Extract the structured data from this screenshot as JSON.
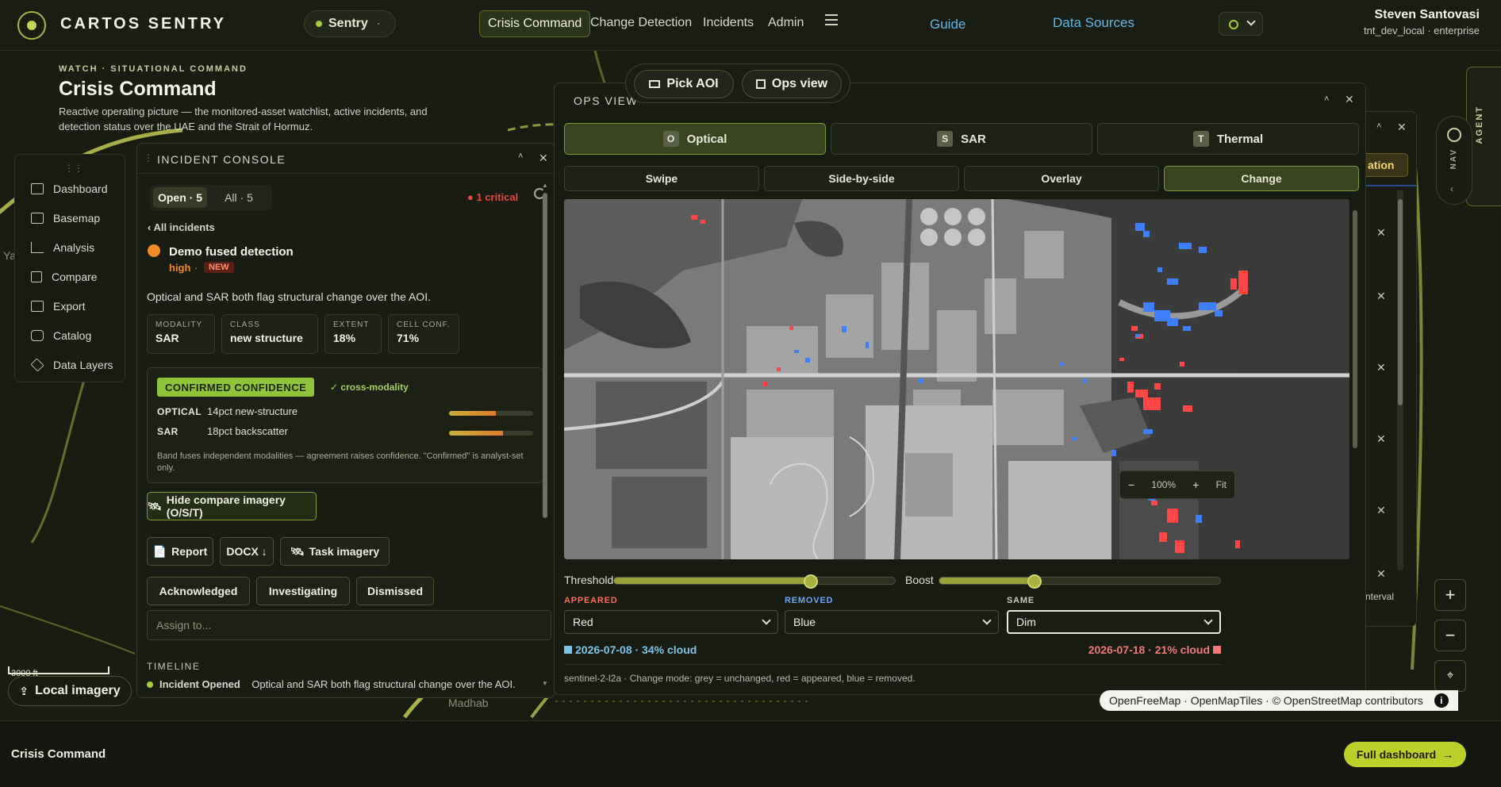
{
  "app": {
    "name": "CARTOS SENTRY",
    "env_label": "Sentry"
  },
  "nav": {
    "tabs": [
      {
        "label": "Crisis Command",
        "active": true
      },
      {
        "label": "Change Detection"
      },
      {
        "label": "Incidents"
      },
      {
        "label": "Admin"
      }
    ],
    "guide": "Guide",
    "data_sources": "Data Sources"
  },
  "user": {
    "name": "Steven Santovasi",
    "context": "tnt_dev_local · enterprise"
  },
  "header": {
    "eyebrow": "WATCH · SITUATIONAL COMMAND",
    "title": "Crisis Command",
    "description": "Reactive operating picture — the monitored-asset watchlist, active incidents, and detection status over the UAE and the Strait of Hormuz."
  },
  "sidebar": {
    "items": [
      {
        "label": "Dashboard",
        "icon": "dashboard-icon"
      },
      {
        "label": "Basemap",
        "icon": "map-icon"
      },
      {
        "label": "Analysis",
        "icon": "chart-icon"
      },
      {
        "label": "Compare",
        "icon": "compare-icon"
      },
      {
        "label": "Export",
        "icon": "export-icon"
      },
      {
        "label": "Catalog",
        "icon": "catalog-icon"
      },
      {
        "label": "Data Layers",
        "icon": "layers-icon"
      }
    ]
  },
  "incident_console": {
    "title": "INCIDENT CONSOLE",
    "tab_open": "Open · 5",
    "tab_all": "All · 5",
    "critical": "● 1 critical",
    "back": "‹ All incidents",
    "incident": {
      "title": "Demo fused detection",
      "severity": "high",
      "sep": "·",
      "badge": "NEW",
      "summary": "Optical and SAR both flag structural change over the AOI."
    },
    "stats": [
      {
        "label": "MODALITY",
        "value": "SAR"
      },
      {
        "label": "CLASS",
        "value": "new structure"
      },
      {
        "label": "EXTENT",
        "value": "18%"
      },
      {
        "label": "CELL CONF.",
        "value": "71%"
      }
    ],
    "confidence": {
      "badge": "CONFIRMED CONFIDENCE",
      "cross": "✓ cross-modality",
      "rows": [
        {
          "label": "OPTICAL",
          "value": "14pct new-structure",
          "level": 0.56
        },
        {
          "label": "SAR",
          "value": "18pct backscatter",
          "level": 0.64
        }
      ],
      "note": "Band fuses independent modalities — agreement raises confidence. \"Confirmed\" is analyst-set only."
    },
    "hide_compare": "Hide compare imagery (O/S/T)",
    "actions": [
      "Report",
      "DOCX ↓",
      "Task imagery"
    ],
    "statuses": [
      "Acknowledged",
      "Investigating",
      "Dismissed"
    ],
    "assign_placeholder": "Assign to...",
    "timeline_title": "TIMELINE",
    "timeline_first": "Incident Opened",
    "timeline_first_desc": "Optical and SAR both flag structural change over the AOI."
  },
  "ops_view": {
    "title": "OPS VIEW",
    "pick_aoi": "Pick AOI",
    "ops_view_btn": "Ops view",
    "modes": [
      {
        "key": "O",
        "label": "Optical",
        "active": true
      },
      {
        "key": "S",
        "label": "SAR"
      },
      {
        "key": "T",
        "label": "Thermal"
      }
    ],
    "compare_modes": [
      {
        "label": "Swipe"
      },
      {
        "label": "Side-by-side"
      },
      {
        "label": "Overlay"
      },
      {
        "label": "Change",
        "active": true
      }
    ],
    "zoom": "100%",
    "zoom_minus": "−",
    "zoom_plus": "+",
    "fit": "Fit",
    "threshold_label": "Threshold",
    "threshold": 0.7,
    "boost_label": "Boost",
    "boost": 0.34,
    "appeared_label": "APPEARED",
    "appeared_value": "Red",
    "removed_label": "REMOVED",
    "removed_value": "Blue",
    "same_label": "SAME",
    "same_value": "Dim",
    "date_left": "2026-07-08 · 34% cloud",
    "date_right": "2026-07-18 · 21% cloud",
    "footnote": "sentinel-2-l2a · Change mode: grey = unchanged, red = appeared, blue = removed.",
    "colors": {
      "appeared": "#ff4747",
      "removed": "#3f7fff",
      "accent": "#8fc43a"
    }
  },
  "right_panel": {
    "tab_fragment": "ation",
    "interval_fragment": "nterval"
  },
  "rails": {
    "nav": "NAV",
    "agent": "AGENT"
  },
  "map": {
    "attribution": "OpenFreeMap · OpenMapTiles · © OpenStreetMap contributors",
    "info": "i",
    "local_imagery": "Local imagery",
    "scale": "3000 ft",
    "place_madhab": "Madhab",
    "place_ya": "Ya",
    "zoom_in": "+",
    "zoom_out": "−"
  },
  "footer": {
    "title": "Crisis Command",
    "full_dashboard": "Full dashboard"
  }
}
